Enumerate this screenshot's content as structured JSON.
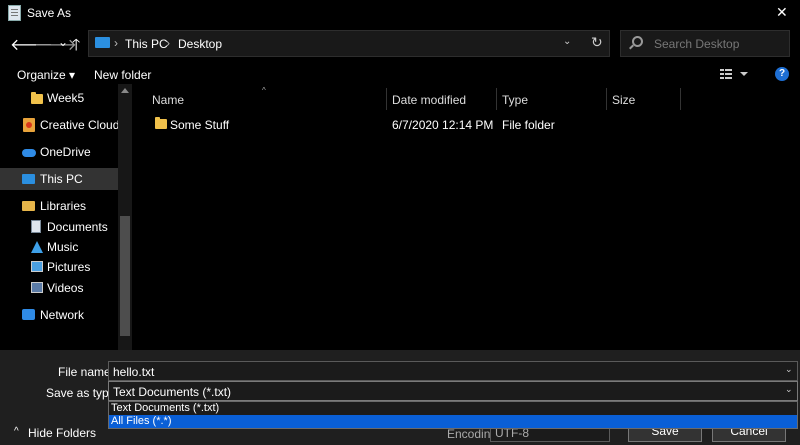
{
  "window": {
    "title": "Save As",
    "close": "✕"
  },
  "nav": {
    "back": "🡐",
    "forward": "🡒",
    "history": "⌄",
    "up": "🡑"
  },
  "address": {
    "crumbs": [
      "This PC",
      "Desktop"
    ],
    "separator": "›",
    "dropdown": "⌄",
    "refresh": "↻"
  },
  "search": {
    "placeholder": "Search Desktop"
  },
  "toolbar": {
    "organize": "Organize ▾",
    "new_folder": "New folder",
    "help": "?"
  },
  "sidebar": {
    "items": [
      {
        "label": "Week5",
        "icon": "folder-icon"
      },
      {
        "label": "Creative Cloud Fil",
        "icon": "creative-cloud-icon"
      },
      {
        "label": "OneDrive",
        "icon": "cloud-icon"
      },
      {
        "label": "This PC",
        "icon": "computer-icon",
        "selected": true
      },
      {
        "label": "Libraries",
        "icon": "libraries-icon"
      },
      {
        "label": "Documents",
        "icon": "documents-icon"
      },
      {
        "label": "Music",
        "icon": "music-icon"
      },
      {
        "label": "Pictures",
        "icon": "pictures-icon"
      },
      {
        "label": "Videos",
        "icon": "videos-icon"
      },
      {
        "label": "Network",
        "icon": "network-icon"
      }
    ]
  },
  "file_list": {
    "columns": [
      "Name",
      "Date modified",
      "Type",
      "Size"
    ],
    "sort_indicator": "^",
    "rows": [
      {
        "name": "Some Stuff",
        "date": "6/7/2020 12:14 PM",
        "type": "File folder",
        "size": ""
      }
    ]
  },
  "form": {
    "file_name_label": "File name:",
    "file_name_value": "hello.txt",
    "type_label": "Save as type:",
    "type_value": "Text Documents (*.txt)",
    "type_options": [
      "Text Documents (*.txt)",
      "All Files  (*.*)"
    ],
    "selected_option": 1,
    "encoding_label": "Encoding:",
    "encoding_value": "UTF-8",
    "arrow": "⌄"
  },
  "buttons": {
    "hide_folders": "Hide Folders",
    "hide_arrow": "^",
    "save": "Save",
    "cancel": "Cancel"
  },
  "colors": {
    "accent": "#0a5fd6",
    "background": "#000000",
    "panel": "#1f1f1f"
  }
}
